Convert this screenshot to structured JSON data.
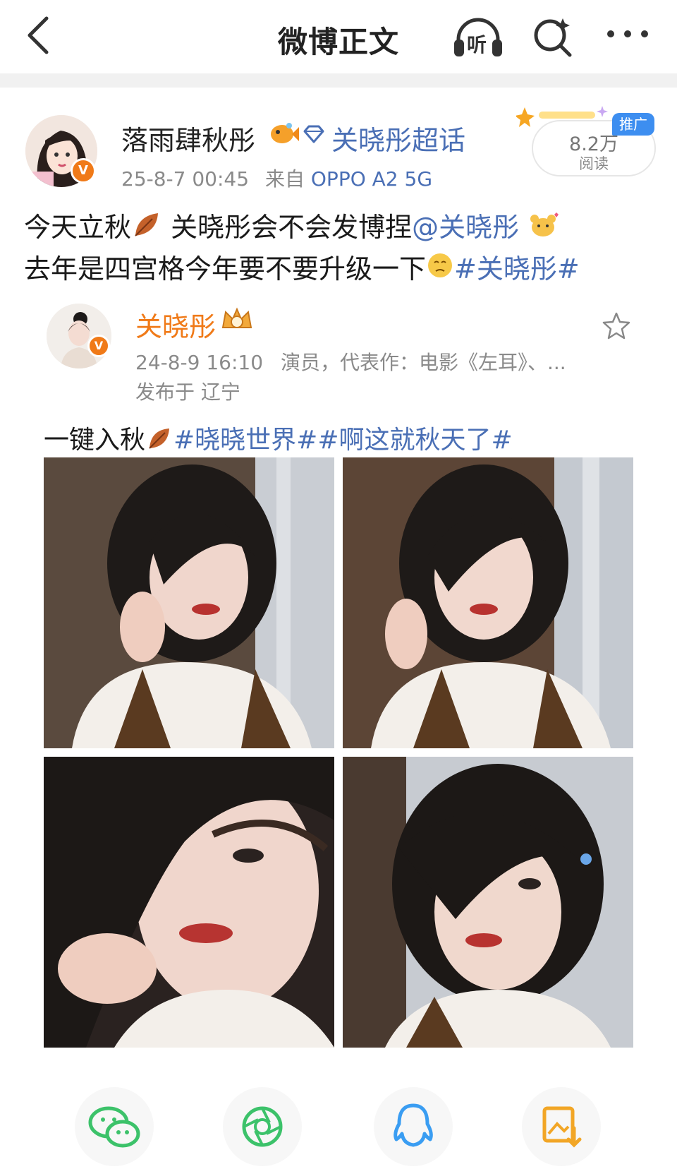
{
  "header": {
    "title": "微博正文",
    "listen_label": "听"
  },
  "post": {
    "author_name": "落雨肆秋彤",
    "supertopic": "关晓彤超话",
    "time": "25-8-7 00:45",
    "source_prefix": "来自",
    "device": "OPPO A2 5G",
    "read_count": "8.2万",
    "read_label": "阅读",
    "promo_badge": "推广",
    "text_line1_a": "今天立秋",
    "text_line1_b": " 关晓彤会不会发博捏",
    "text_line1_mention": "@关晓彤",
    "text_line2_a": "去年是四宫格今年要不要升级一下",
    "text_line2_tag": "#关晓彤#"
  },
  "repost": {
    "author_name": "关晓彤",
    "time": "24-8-9 16:10",
    "bio": "演员，代表作：电影《左耳》、...",
    "location": "发布于 辽宁",
    "text_a": "一键入秋",
    "text_tags": "#晓晓世界##啊这就秋天了#",
    "photos": [
      "photo-1",
      "photo-2",
      "photo-3",
      "photo-4"
    ]
  },
  "share": {
    "items": [
      "wechat-icon",
      "moments-icon",
      "qq-icon",
      "save-image-icon"
    ]
  },
  "colors": {
    "link": "#4a6fb5",
    "vip_name": "#f07a18",
    "verified": "#f07a18"
  }
}
